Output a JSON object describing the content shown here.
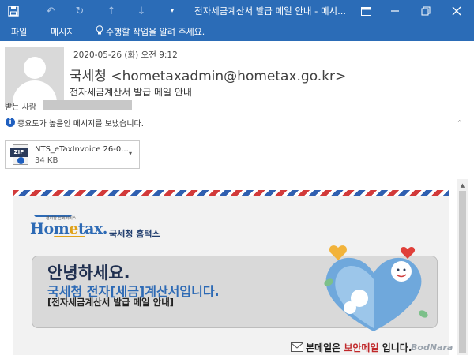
{
  "window": {
    "title": "전자세금계산서 발급 메일 안내 - 메시..."
  },
  "ribbon": {
    "tabs": [
      "파일",
      "메시지"
    ],
    "tell_me": "수행할 작업을 알려 주세요."
  },
  "message": {
    "date": "2020-05-26 (화) 오전 9:12",
    "sender": "국세청 <hometaxadmin@hometax.go.kr>",
    "subject": "전자세금계산서 발급 메일 안내",
    "to_label": "받는 사람",
    "importance": "중요도가 높음인 메시지를 보냈습니다."
  },
  "attachment": {
    "type_label": "ZIP",
    "name": "NTS_eTaxInvoice 26-0...",
    "size": "34 KB"
  },
  "body": {
    "logo_tagline": "편리한 납세서비스",
    "logo_home": "Hom",
    "logo_e": "e",
    "logo_tax": "tax.",
    "logo_sub": "국세청 홈택스",
    "greeting_line1": "안녕하세요.",
    "greeting_line2": "국세청 전자[세금]계산서입니다.",
    "greeting_line3": "[전자세금계산서 발급 메일 안내]",
    "notice_prefix": "본메일은 ",
    "notice_highlight": "보안메일",
    "notice_suffix": " 입니다."
  },
  "watermark": "BodNara",
  "colors": {
    "titlebar": "#2b6cb7",
    "brand_blue": "#2d6ab5",
    "highlight_red": "#c0282a"
  }
}
